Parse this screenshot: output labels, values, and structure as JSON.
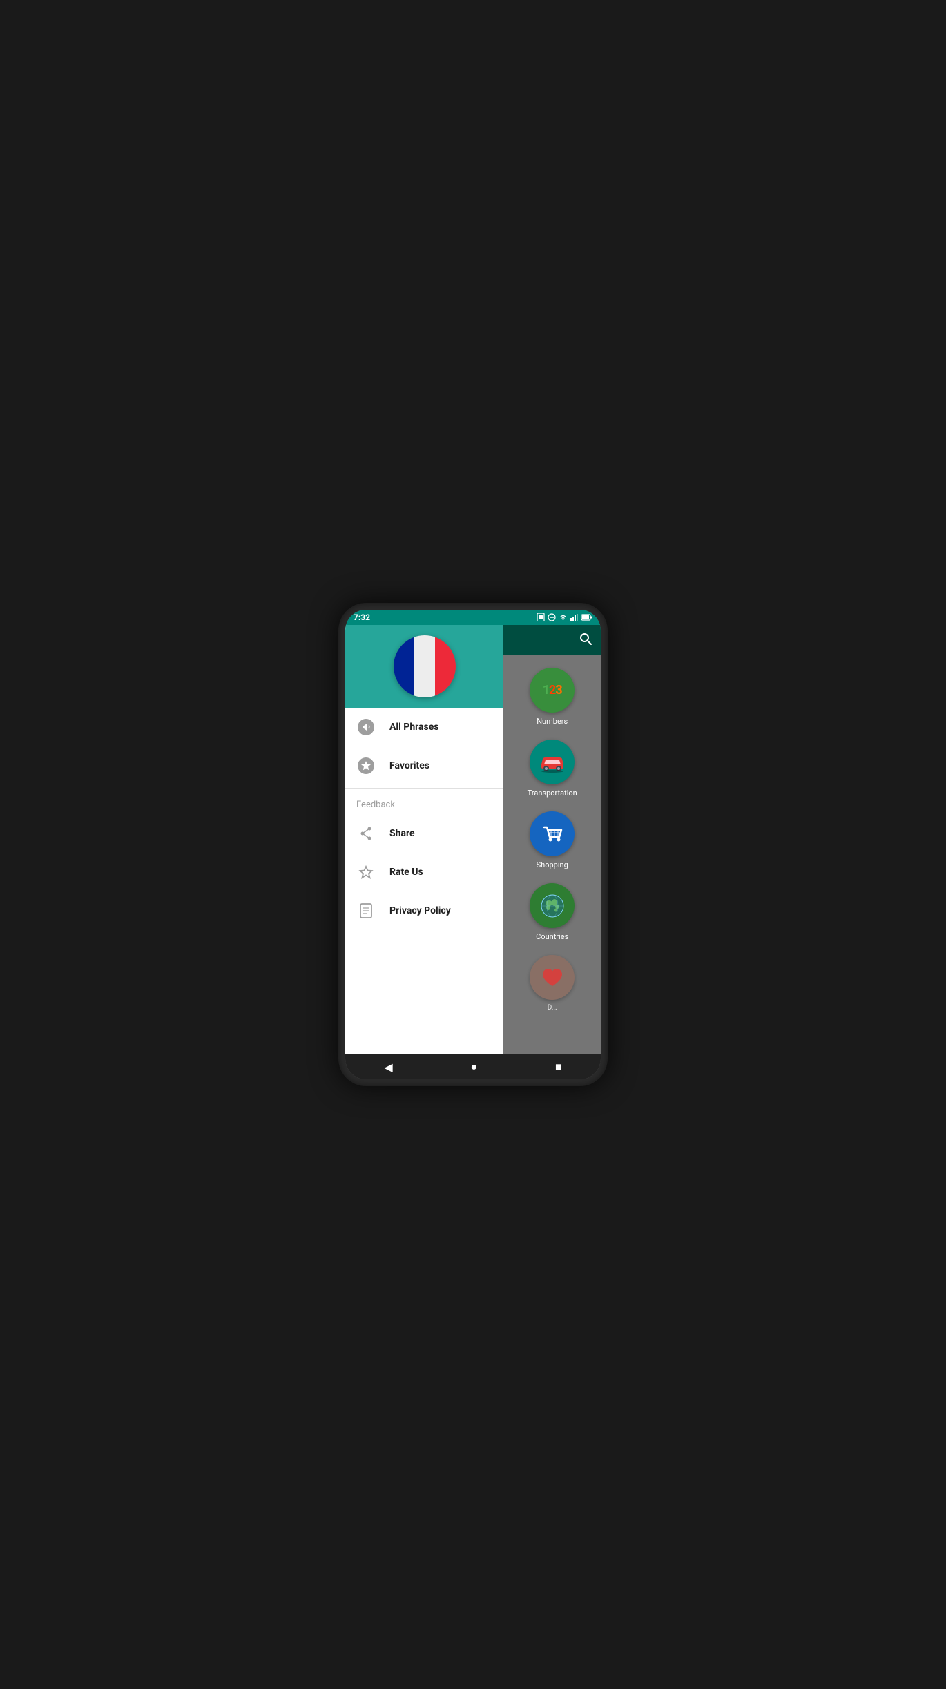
{
  "status_bar": {
    "time": "7:32",
    "icons": [
      "sim",
      "do-not-disturb",
      "wifi",
      "signal",
      "battery"
    ]
  },
  "flag": {
    "country": "France",
    "colors": [
      "#002395",
      "#EDEDED",
      "#ED2939"
    ]
  },
  "drawer": {
    "menu_items": [
      {
        "id": "all-phrases",
        "label": "All Phrases",
        "icon": "megaphone"
      },
      {
        "id": "favorites",
        "label": "Favorites",
        "icon": "star-filled"
      }
    ],
    "section_feedback": "Feedback",
    "feedback_items": [
      {
        "id": "share",
        "label": "Share",
        "icon": "share"
      },
      {
        "id": "rate-us",
        "label": "Rate Us",
        "icon": "star-outline"
      },
      {
        "id": "privacy-policy",
        "label": "Privacy Policy",
        "icon": "document"
      }
    ]
  },
  "right_panel": {
    "search_placeholder": "Search",
    "categories": [
      {
        "id": "numbers",
        "label": "Numbers",
        "color": "#388E3C",
        "icon": "numbers"
      },
      {
        "id": "transportation",
        "label": "Transportation",
        "color": "#00897B",
        "icon": "car"
      },
      {
        "id": "shopping",
        "label": "Shopping",
        "color": "#1565C0",
        "icon": "cart"
      },
      {
        "id": "countries",
        "label": "Countries",
        "color": "#2E7D32",
        "icon": "globe"
      },
      {
        "id": "dating",
        "label": "Dating",
        "color": "#8D6E63",
        "icon": "heart"
      }
    ]
  },
  "nav_bar": {
    "back_label": "◀",
    "home_label": "●",
    "recent_label": "■"
  }
}
